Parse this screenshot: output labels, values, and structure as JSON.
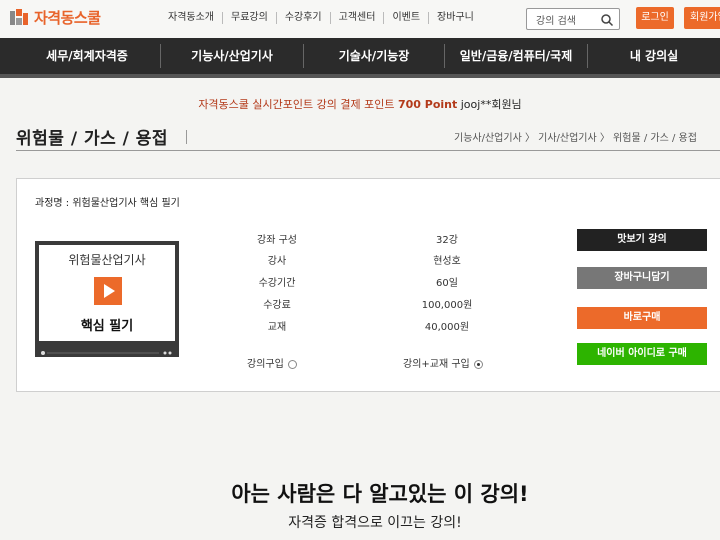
{
  "header": {
    "logo_text": "자격동스쿨",
    "menu": [
      "자격동소개",
      "무료강의",
      "수강후기",
      "고객센터",
      "이벤트",
      "장바구니"
    ],
    "search_placeholder": "강의 검색",
    "login_label": "로그인",
    "join_label": "회원가입"
  },
  "nav": {
    "items": [
      "세무/회계자격증",
      "기능사/산업기사",
      "기술사/기능장",
      "일반/금융/컴퓨터/국제",
      "내 강의실"
    ]
  },
  "banner": {
    "prefix": "자격동스쿨 실시간포인트 강의 결제 포인트",
    "points": "700 Point",
    "user": "jooj**회원님"
  },
  "page": {
    "title": "위험물 / 가스 / 용접",
    "breadcrumb": "기능사/산업기사 〉 기사/산업기사 〉 위험물 / 가스 / 용접"
  },
  "course": {
    "name": "과정명 : 위험물산업기사 핵심 필기",
    "thumb_title": "위험물산업기사",
    "thumb_subtitle": "핵심 필기",
    "info": [
      {
        "label": "강좌 구성",
        "value": "32강"
      },
      {
        "label": "강사",
        "value": "현성호"
      },
      {
        "label": "수강기간",
        "value": "60일"
      },
      {
        "label": "수강료",
        "value": "100,000원"
      },
      {
        "label": "교재",
        "value": "40,000원"
      }
    ],
    "option_lecture": "강의구입",
    "option_lecture_book": "강의+교재 구입",
    "buttons": {
      "preview": "맛보기 강의",
      "cart": "장바구니담기",
      "buy": "바로구매",
      "naver": "네이버 아이디로 구매"
    }
  },
  "promo": {
    "headline": "아는 사람은 다 알고있는 이 강의!",
    "subline": "자격증 합격으로 이끄는 강의!"
  },
  "colors": {
    "accent": "#ec6a2a",
    "nav_bg": "#2b2b2b",
    "preview_btn": "#222222",
    "cart_btn": "#777777",
    "buy_btn": "#ec6a2a",
    "naver_btn": "#2db400"
  }
}
